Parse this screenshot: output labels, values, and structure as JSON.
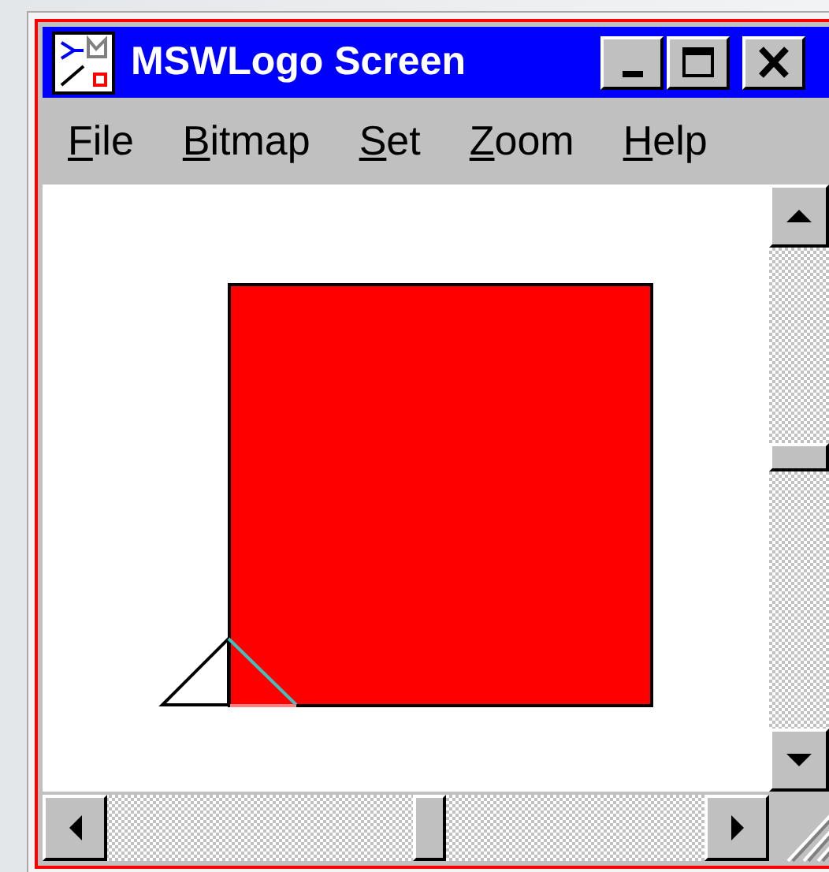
{
  "window": {
    "title": "MSWLogo Screen"
  },
  "menu": [
    {
      "label": "File"
    },
    {
      "label": "Bitmap"
    },
    {
      "label": "Set"
    },
    {
      "label": "Zoom"
    },
    {
      "label": "Help"
    }
  ]
}
